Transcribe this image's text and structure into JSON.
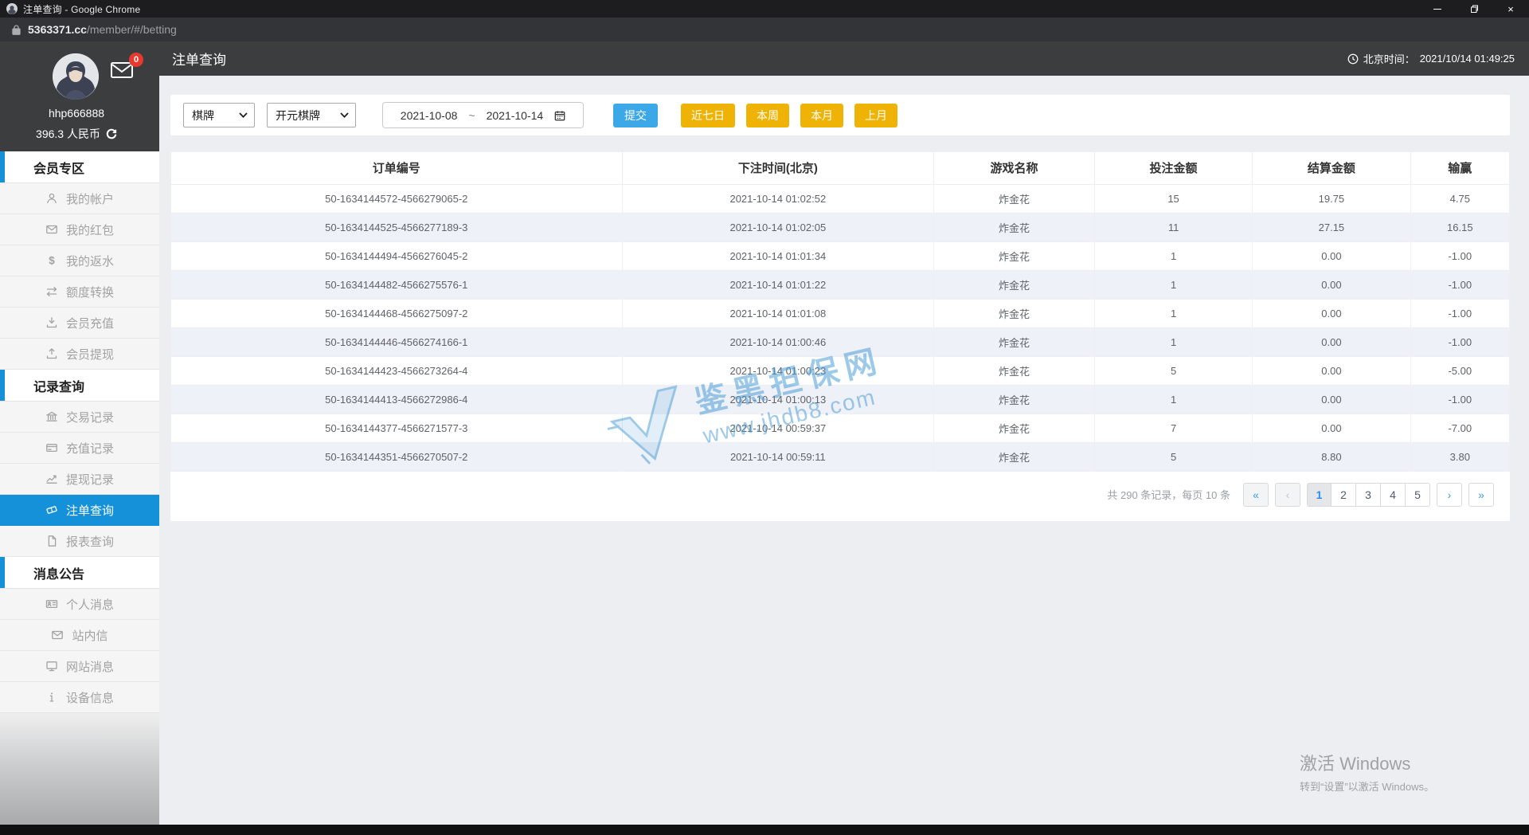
{
  "window": {
    "title": "注单查询 - Google Chrome",
    "url_host": "5363371.cc",
    "url_path": "/member/#/betting"
  },
  "header": {
    "page_title": "注单查询",
    "time_label": "北京时间：",
    "time_value": "2021/10/14 01:49:25"
  },
  "user": {
    "username": "hhp666888",
    "balance": "396.3 人民币",
    "mail_badge": "0"
  },
  "sidebar": {
    "sections": [
      {
        "title": "会员专区",
        "items": [
          {
            "id": "my-account",
            "icon": "account-icon",
            "label": "我的帐户"
          },
          {
            "id": "my-redpacket",
            "icon": "redpacket-icon",
            "label": "我的红包"
          },
          {
            "id": "my-rebate",
            "icon": "rebate-icon",
            "label": "我的返水"
          },
          {
            "id": "quota-transfer",
            "icon": "transfer-icon",
            "label": "额度转换"
          },
          {
            "id": "member-deposit",
            "icon": "deposit-icon",
            "label": "会员充值"
          },
          {
            "id": "member-withdraw",
            "icon": "withdraw-icon",
            "label": "会员提现"
          }
        ]
      },
      {
        "title": "记录查询",
        "items": [
          {
            "id": "transaction-records",
            "icon": "bank-icon",
            "label": "交易记录"
          },
          {
            "id": "deposit-records",
            "icon": "card-icon",
            "label": "充值记录"
          },
          {
            "id": "withdraw-records",
            "icon": "chart-icon",
            "label": "提现记录"
          },
          {
            "id": "bet-query",
            "icon": "ticket-icon",
            "label": "注单查询",
            "active": true
          },
          {
            "id": "report-query",
            "icon": "report-icon",
            "label": "报表查询"
          }
        ]
      },
      {
        "title": "消息公告",
        "items": [
          {
            "id": "personal-messages",
            "icon": "idcard-icon",
            "label": "个人消息"
          },
          {
            "id": "site-mail",
            "icon": "mail2-icon",
            "label": "站内信"
          },
          {
            "id": "site-messages",
            "icon": "monitor-icon",
            "label": "网站消息"
          },
          {
            "id": "device-info",
            "icon": "info-icon",
            "label": "设备信息"
          }
        ]
      }
    ]
  },
  "filters": {
    "category": "棋牌",
    "platform": "开元棋牌",
    "date_from": "2021-10-08",
    "date_tilde": "~",
    "date_to": "2021-10-14",
    "submit_label": "提交",
    "quick_buttons": [
      "近七日",
      "本周",
      "本月",
      "上月"
    ]
  },
  "table": {
    "columns": [
      "订单编号",
      "下注时间(北京)",
      "游戏名称",
      "投注金额",
      "结算金额",
      "输赢"
    ],
    "rows": [
      [
        "50-1634144572-4566279065-2",
        "2021-10-14 01:02:52",
        "炸金花",
        "15",
        "19.75",
        "4.75"
      ],
      [
        "50-1634144525-4566277189-3",
        "2021-10-14 01:02:05",
        "炸金花",
        "11",
        "27.15",
        "16.15"
      ],
      [
        "50-1634144494-4566276045-2",
        "2021-10-14 01:01:34",
        "炸金花",
        "1",
        "0.00",
        "-1.00"
      ],
      [
        "50-1634144482-4566275576-1",
        "2021-10-14 01:01:22",
        "炸金花",
        "1",
        "0.00",
        "-1.00"
      ],
      [
        "50-1634144468-4566275097-2",
        "2021-10-14 01:01:08",
        "炸金花",
        "1",
        "0.00",
        "-1.00"
      ],
      [
        "50-1634144446-4566274166-1",
        "2021-10-14 01:00:46",
        "炸金花",
        "1",
        "0.00",
        "-1.00"
      ],
      [
        "50-1634144423-4566273264-4",
        "2021-10-14 01:00:23",
        "炸金花",
        "5",
        "0.00",
        "-5.00"
      ],
      [
        "50-1634144413-4566272986-4",
        "2021-10-14 01:00:13",
        "炸金花",
        "1",
        "0.00",
        "-1.00"
      ],
      [
        "50-1634144377-4566271577-3",
        "2021-10-14 00:59:37",
        "炸金花",
        "7",
        "0.00",
        "-7.00"
      ],
      [
        "50-1634144351-4566270507-2",
        "2021-10-14 00:59:11",
        "炸金花",
        "5",
        "8.80",
        "3.80"
      ]
    ]
  },
  "pagination": {
    "summary": "共 290 条记录，每页 10 条",
    "first_label": "«",
    "prev_label": "‹",
    "pages": [
      "1",
      "2",
      "3",
      "4",
      "5"
    ],
    "active_page": "1",
    "next_label": "›",
    "last_label": "»"
  },
  "watermark": {
    "brand": "鉴黑担保网",
    "url": "www.jhdb8.com"
  },
  "activation": {
    "line1": "激活 Windows",
    "line2": "转到“设置”以激活 Windows。"
  },
  "colors": {
    "accent_blue": "#1591d9",
    "submit_blue": "#3da8e8",
    "quick_yellow": "#efb306",
    "badge_red": "#e8392f",
    "watermark_blue": "#4f9fd8"
  }
}
